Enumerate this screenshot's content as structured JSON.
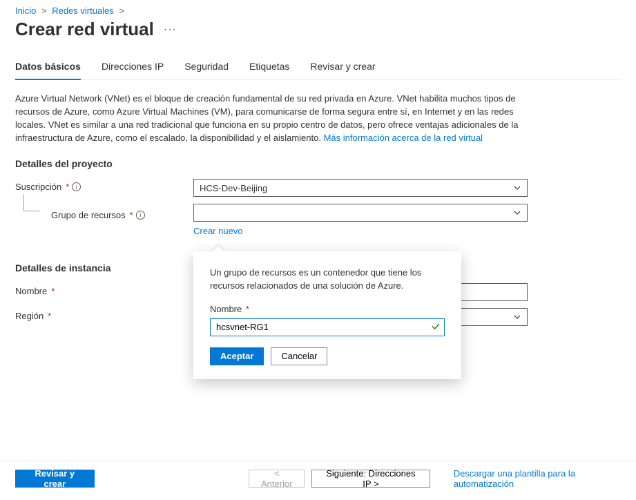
{
  "breadcrumb": {
    "home": "Inicio",
    "vnets": "Redes virtuales"
  },
  "title": "Crear red virtual",
  "tabs": {
    "basics": "Datos básicos",
    "ips": "Direcciones IP",
    "security": "Seguridad",
    "tags": "Etiquetas",
    "review": "Revisar y crear"
  },
  "intro": {
    "text": "Azure Virtual Network (VNet) es el bloque de creación fundamental de su red privada en Azure. VNet habilita muchos tipos de recursos de Azure, como Azure Virtual Machines (VM), para comunicarse de forma segura entre sí, en Internet y en las redes locales. VNet es similar a una red tradicional que funciona en su propio centro de datos, pero ofrece ventajas adicionales de la infraestructura de Azure, como el escalado, la disponibilidad y el aislamiento.  ",
    "link": "Más información acerca de la red virtual"
  },
  "sections": {
    "project": "Detalles del proyecto",
    "instance": "Detalles de instancia"
  },
  "labels": {
    "subscription": "Suscripción",
    "resourceGroup": "Grupo de recursos",
    "createNew": "Crear nuevo",
    "name": "Nombre",
    "region": "Región"
  },
  "values": {
    "subscription": "HCS-Dev-Beijing",
    "resourceGroup": "",
    "name": "",
    "region": ""
  },
  "popover": {
    "desc": "Un grupo de recursos es un contenedor que tiene los recursos relacionados de una solución de Azure.",
    "nameLabel": "Nombre",
    "nameValue": "hcsvnet-RG1",
    "ok": "Aceptar",
    "cancel": "Cancelar"
  },
  "footer": {
    "review": "Revisar y crear",
    "prev": "< Anterior",
    "next": "Siguiente: Direcciones IP >",
    "download": "Descargar una plantilla para la automatización"
  }
}
